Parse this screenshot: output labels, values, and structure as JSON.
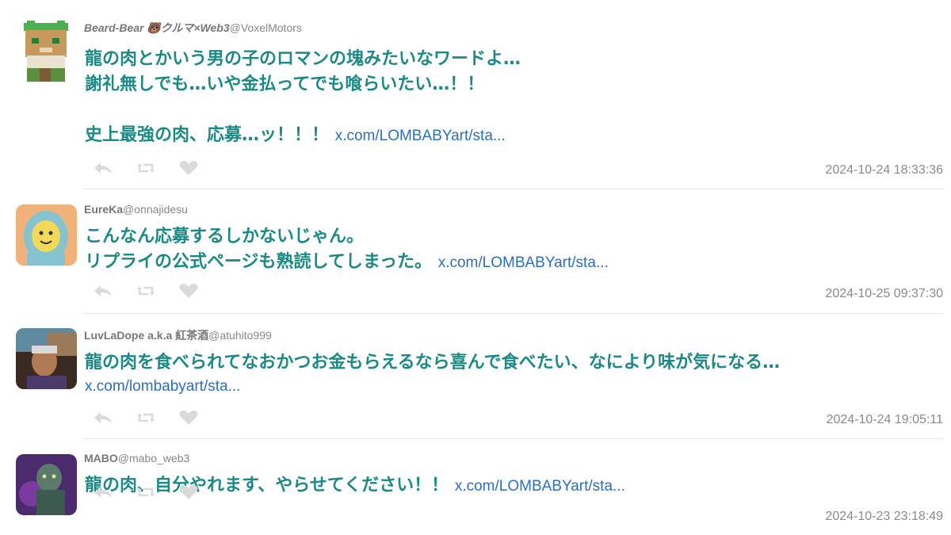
{
  "colors": {
    "body_text": "#1b8a86",
    "link": "#2a6ec2",
    "meta": "#8a8a8a",
    "action_icon": "#dadada"
  },
  "tweets": [
    {
      "display_name": "Beard-Bear 🐻クルマ×Web3",
      "handle": "@VoxelMotors",
      "text": "龍の肉とかいう男の子のロマンの塊みたいなワードよ…\n謝礼無しでも…いや金払ってでも喰らいたい…！！\n\n史上最強の肉、応募…ッ！！！",
      "link": "x.com/LOMBABYart/sta...",
      "timestamp": "2024-10-24 18:33:36"
    },
    {
      "display_name": "EureKa",
      "handle": "@onnajidesu",
      "text": "こんなん応募するしかないじゃん。\nリプライの公式ページも熟読してしまった。",
      "link": "x.com/LOMBABYart/sta...",
      "timestamp": "2024-10-25 09:37:30"
    },
    {
      "display_name": "LuvLaDope a.k.a 紅茶酒",
      "handle": "@atuhito999",
      "text": "龍の肉を食べられてなおかつお金もらえるなら喜んで食べたい、なにより味が気になる…",
      "link": "x.com/lombabyart/sta...",
      "timestamp": "2024-10-24 19:05:11"
    },
    {
      "display_name": "MABO",
      "handle": "@mabo_web3",
      "text": "龍の肉、自分やれます、やらせてください！！",
      "link": "x.com/LOMBABYart/sta...",
      "timestamp": "2024-10-23 23:18:49"
    }
  ],
  "action_icons": [
    "reply-icon",
    "retweet-icon",
    "like-icon"
  ]
}
